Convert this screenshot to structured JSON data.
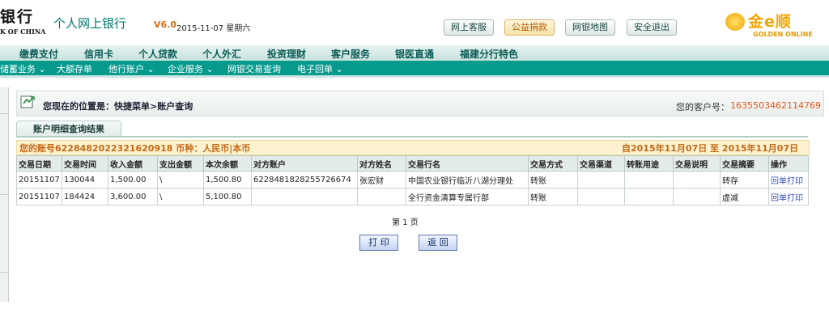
{
  "header": {
    "bank_name": "银行",
    "bank_name_en": "K OF CHINA",
    "app_title": "个人网上银行",
    "version": "V6.0",
    "date": "2015-11-07 星期六",
    "buttons": [
      "网上客服",
      "公益捐款",
      "网银地图",
      "安全退出"
    ],
    "logo_text": "金e顺",
    "logo_text_en": "GOLDEN ONLINE"
  },
  "menu_primary": [
    "缴费支付",
    "信用卡",
    "个人贷款",
    "个人外汇",
    "投资理财",
    "客户服务",
    "银医直通",
    "福建分行特色"
  ],
  "menu_secondary": [
    "储蓄业务 ⌄",
    "大额存单",
    "他行账户 ⌄",
    "企业服务 ⌄",
    "网银交易查询",
    "电子回单 ⌄"
  ],
  "location": {
    "text": "您现在的位置是：快捷菜单>账户查询",
    "customer_label": "您的客户号：",
    "customer_no": "1635503462114769"
  },
  "tab_title": "账户明细查询结果",
  "account_bar": {
    "left": "您的账号6228482022321620918 币种：人民币|本币",
    "right": "自2015年11月07日  至  2015年11月07日"
  },
  "table": {
    "headers": [
      "交易日期",
      "交易时间",
      "收入金额",
      "支出金额",
      "本次余额",
      "对方账户",
      "对方姓名",
      "交易行名",
      "交易方式",
      "交易渠道",
      "转账用途",
      "交易说明",
      "交易摘要",
      "操作"
    ],
    "rows": [
      [
        "20151107",
        "130044",
        "1,500.00",
        "\\",
        "1,500.80",
        "6228481828255726674",
        "张宏财",
        "中国农业银行临沂八湖分理处",
        "转账",
        "",
        "",
        "",
        "转存",
        "回单打印"
      ],
      [
        "20151107",
        "184424",
        "3,600.00",
        "\\",
        "5,100.80",
        "",
        "",
        "全行资金清算专属行部",
        "转账",
        "",
        "",
        "",
        "虚减",
        "回单打印"
      ]
    ]
  },
  "page_label": "第 1 页",
  "actions": {
    "print": "打 印",
    "back": "返 回"
  },
  "colors": {
    "teal": "#069a8d",
    "orange": "#e4571c",
    "gold": "#f2a400"
  }
}
